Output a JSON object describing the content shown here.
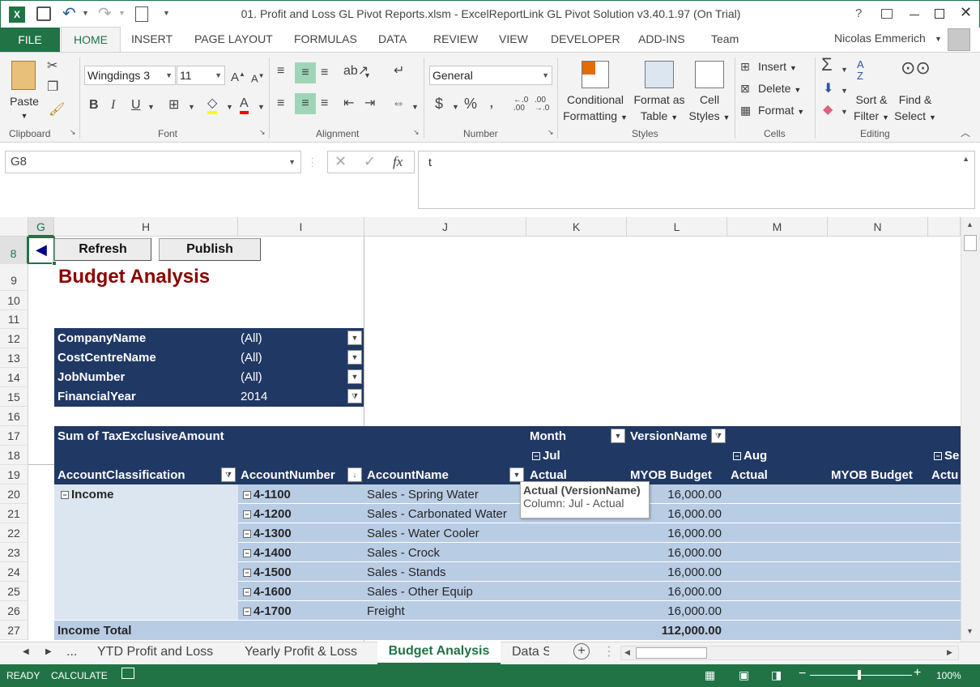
{
  "window": {
    "title": "01. Profit and Loss GL Pivot Reports.xlsm - ExcelReportLink GL Pivot Solution v3.40.1.97 (On Trial)",
    "help": "?",
    "user": "Nicolas Emmerich"
  },
  "ribbon_tabs": [
    "FILE",
    "HOME",
    "INSERT",
    "PAGE LAYOUT",
    "FORMULAS",
    "DATA",
    "REVIEW",
    "VIEW",
    "DEVELOPER",
    "ADD-INS",
    "Team"
  ],
  "ribbon": {
    "clipboard": {
      "paste": "Paste",
      "label": "Clipboard"
    },
    "font": {
      "name": "Wingdings 3",
      "size": "11",
      "label": "Font",
      "bold": "B",
      "italic": "I",
      "underline": "U"
    },
    "alignment": {
      "label": "Alignment"
    },
    "number": {
      "format": "General",
      "label": "Number",
      "currency": "$",
      "percent": "%",
      "comma": ","
    },
    "styles": {
      "conditional": "Conditional",
      "conditional2": "Formatting",
      "format_as": "Format as",
      "format_as2": "Table",
      "cell": "Cell",
      "cell2": "Styles",
      "label": "Styles"
    },
    "cells": {
      "insert": "Insert",
      "delete": "Delete",
      "format": "Format",
      "label": "Cells"
    },
    "editing": {
      "sort": "Sort &",
      "sort2": "Filter",
      "find": "Find &",
      "find2": "Select",
      "label": "Editing"
    }
  },
  "formula_bar": {
    "name_box": "G8",
    "fx": "fx",
    "value": "t"
  },
  "columns": [
    "G",
    "H",
    "I",
    "J",
    "K",
    "L",
    "M",
    "N"
  ],
  "rows": [
    "8",
    "9",
    "10",
    "11",
    "12",
    "13",
    "14",
    "15",
    "16",
    "17",
    "18",
    "19",
    "20",
    "21",
    "22",
    "23",
    "24",
    "25",
    "26",
    "27"
  ],
  "buttons": {
    "refresh": "Refresh",
    "publish": "Publish"
  },
  "report_title": "Budget Analysis",
  "filters": [
    {
      "field": "CompanyName",
      "value": "(All)"
    },
    {
      "field": "CostCentreName",
      "value": "(All)"
    },
    {
      "field": "JobNumber",
      "value": "(All)"
    },
    {
      "field": "FinancialYear",
      "value": "2014"
    }
  ],
  "pivot": {
    "values_label": "Sum of TaxExclusiveAmount",
    "month_label": "Month",
    "version_label": "VersionName",
    "months": [
      "Jul",
      "Aug",
      "Se"
    ],
    "headers": [
      "AccountClassification",
      "AccountNumber",
      "AccountName",
      "Actual",
      "MYOB Budget",
      "Actual",
      "MYOB Budget",
      "Actu"
    ],
    "classification": "Income",
    "rows": [
      {
        "number": "4-1100",
        "name": "Sales - Spring Water",
        "budget": "16,000.00"
      },
      {
        "number": "4-1200",
        "name": "Sales - Carbonated Water",
        "budget": "16,000.00"
      },
      {
        "number": "4-1300",
        "name": "Sales - Water Cooler",
        "budget": "16,000.00"
      },
      {
        "number": "4-1400",
        "name": "Sales - Crock",
        "budget": "16,000.00"
      },
      {
        "number": "4-1500",
        "name": "Sales - Stands",
        "budget": "16,000.00"
      },
      {
        "number": "4-1600",
        "name": "Sales - Other Equip",
        "budget": "16,000.00"
      },
      {
        "number": "4-1700",
        "name": "Freight",
        "budget": "16,000.00"
      }
    ],
    "total_label": "Income Total",
    "total_budget": "112,000.00"
  },
  "tooltip": {
    "title": "Actual (VersionName)",
    "detail": "Column: Jul - Actual"
  },
  "sheet_tabs": [
    "...",
    "YTD Profit and Loss",
    "Yearly Profit & Loss",
    "Budget Analysis",
    "Data S"
  ],
  "status": {
    "ready": "READY",
    "calculate": "CALCULATE",
    "zoom": "100%"
  },
  "colors": {
    "excel_green": "#217346",
    "pivot_navy": "#203864",
    "pivot_light": "#b8cce4",
    "title_red": "#8b0000"
  }
}
